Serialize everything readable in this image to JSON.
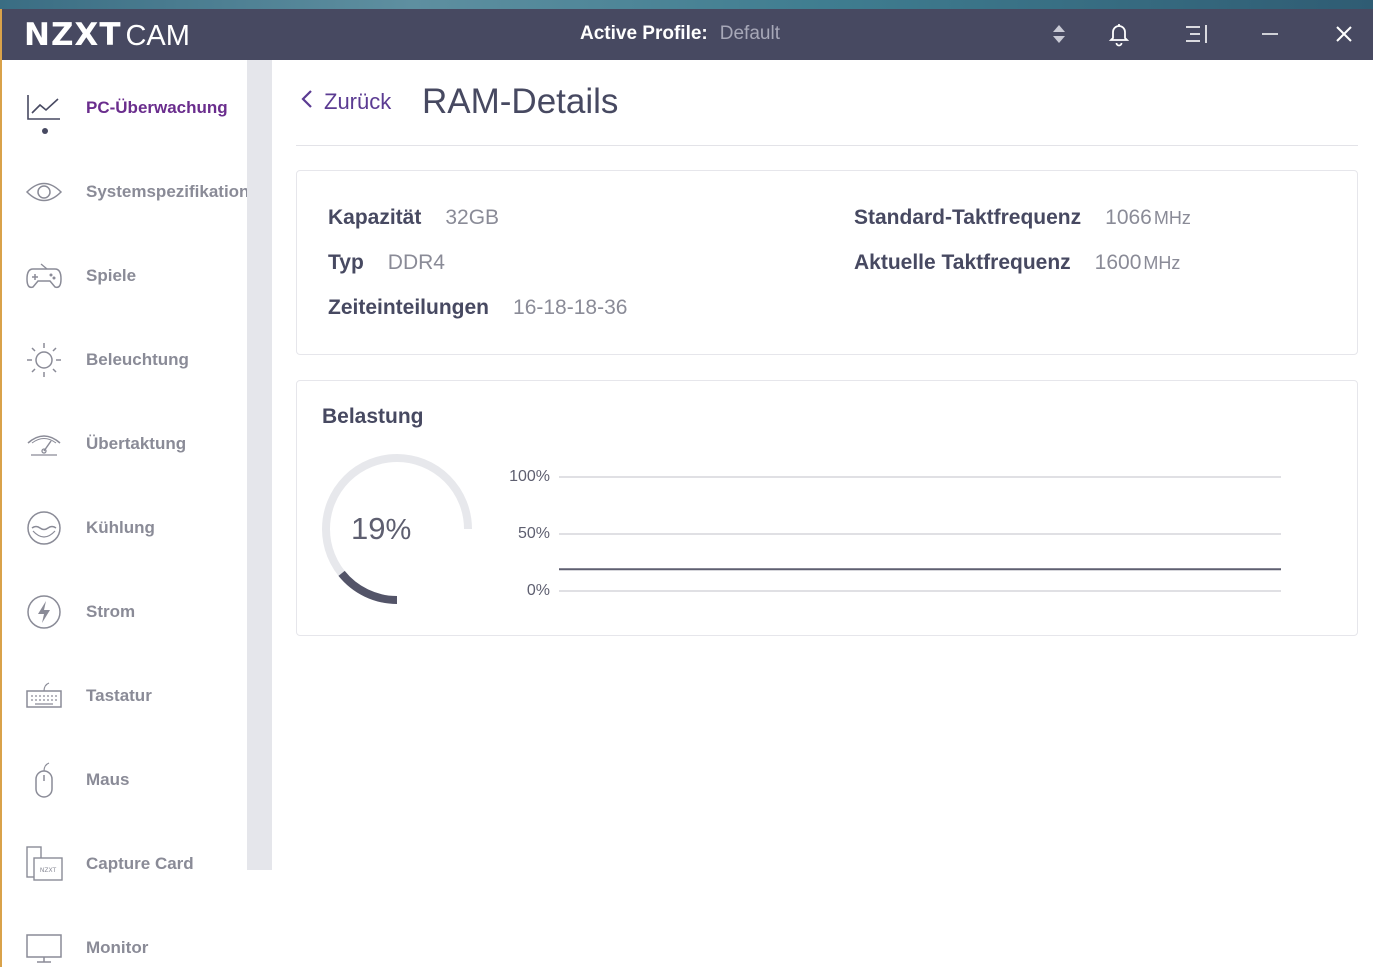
{
  "app": {
    "logo_brand": "NZXT",
    "logo_product": "CAM",
    "profile_label": "Active Profile:",
    "profile_value": "Default"
  },
  "sidebar": {
    "items": [
      {
        "label": "PC-Überwachung",
        "icon": "line-chart-icon",
        "active": true
      },
      {
        "label": "Systemspezifikation",
        "icon": "eye-icon",
        "active": false
      },
      {
        "label": "Spiele",
        "icon": "gamepad-icon",
        "active": false
      },
      {
        "label": "Beleuchtung",
        "icon": "sun-icon",
        "active": false
      },
      {
        "label": "Übertaktung",
        "icon": "speedometer-icon",
        "active": false
      },
      {
        "label": "Kühlung",
        "icon": "water-bowl-icon",
        "active": false
      },
      {
        "label": "Strom",
        "icon": "lightning-icon",
        "active": false
      },
      {
        "label": "Tastatur",
        "icon": "keyboard-icon",
        "active": false
      },
      {
        "label": "Maus",
        "icon": "mouse-icon",
        "active": false
      },
      {
        "label": "Capture Card",
        "icon": "capture-card-icon",
        "active": false
      },
      {
        "label": "Monitor",
        "icon": "monitor-icon",
        "active": false
      }
    ]
  },
  "main": {
    "back_label": "Zurück",
    "title": "RAM-Details",
    "specs": {
      "capacity_label": "Kapazität",
      "capacity_value": "32GB",
      "type_label": "Typ",
      "type_value": "DDR4",
      "timings_label": "Zeiteinteilungen",
      "timings_value": "16-18-18-36",
      "std_clock_label": "Standard-Taktfrequenz",
      "std_clock_value": "1066",
      "std_clock_unit": "MHz",
      "cur_clock_label": "Aktuelle Taktfrequenz",
      "cur_clock_value": "1600",
      "cur_clock_unit": "MHz"
    },
    "load": {
      "title": "Belastung",
      "value": "19",
      "unit": "%",
      "fraction": 0.19,
      "axis_labels": [
        "100%",
        "50%",
        "0%"
      ],
      "history_level": 0.19
    }
  },
  "colors": {
    "titlebar": "#474961",
    "accent": "#6a2d8d",
    "text_dark": "#474961",
    "text_muted": "#8a8b97"
  }
}
